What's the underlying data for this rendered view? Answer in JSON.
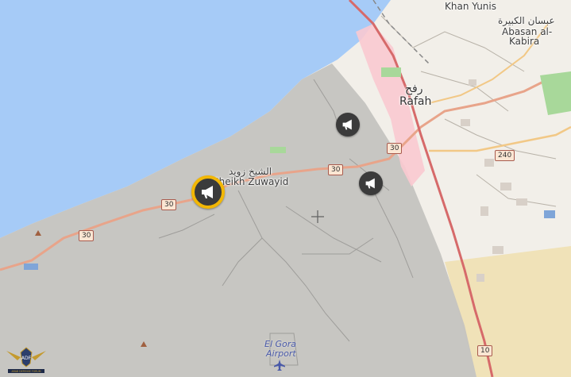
{
  "map": {
    "colors": {
      "sea": "#a6cbf7",
      "land": "#f2efe9",
      "restricted_area": "#c4c3c0",
      "border_zone": "#f9c9d0",
      "desert": "#f0e2b8",
      "road": "#e8a48a",
      "border_road": "#d66a6a"
    },
    "places": {
      "khan_yunis": "Khan Yunis",
      "abasan_arabic": "عبسان الكبيرة",
      "abasan_line1": "Abasan al-",
      "abasan_line2": "Kabira",
      "rafah_arabic": "رفح",
      "rafah": "Rafah",
      "sheikh_arabic": "الشيخ زويد",
      "sheikh": "Sheikh Zuwayid",
      "airport_line1": "El Gora",
      "airport_line2": "Airport"
    },
    "road_shields": {
      "r30_west": "30",
      "r30_mid": "30",
      "r30_center": "30",
      "r30_east": "30",
      "r240": "240",
      "r10": "10"
    },
    "markers": [
      {
        "id": "event-marker-selected",
        "icon": "megaphone-icon",
        "selected": true
      },
      {
        "id": "event-marker-north",
        "icon": "megaphone-icon",
        "selected": false
      },
      {
        "id": "event-marker-east",
        "icon": "megaphone-icon",
        "selected": false
      }
    ],
    "logo_text": "ARAB DEFENSE FORUM"
  }
}
